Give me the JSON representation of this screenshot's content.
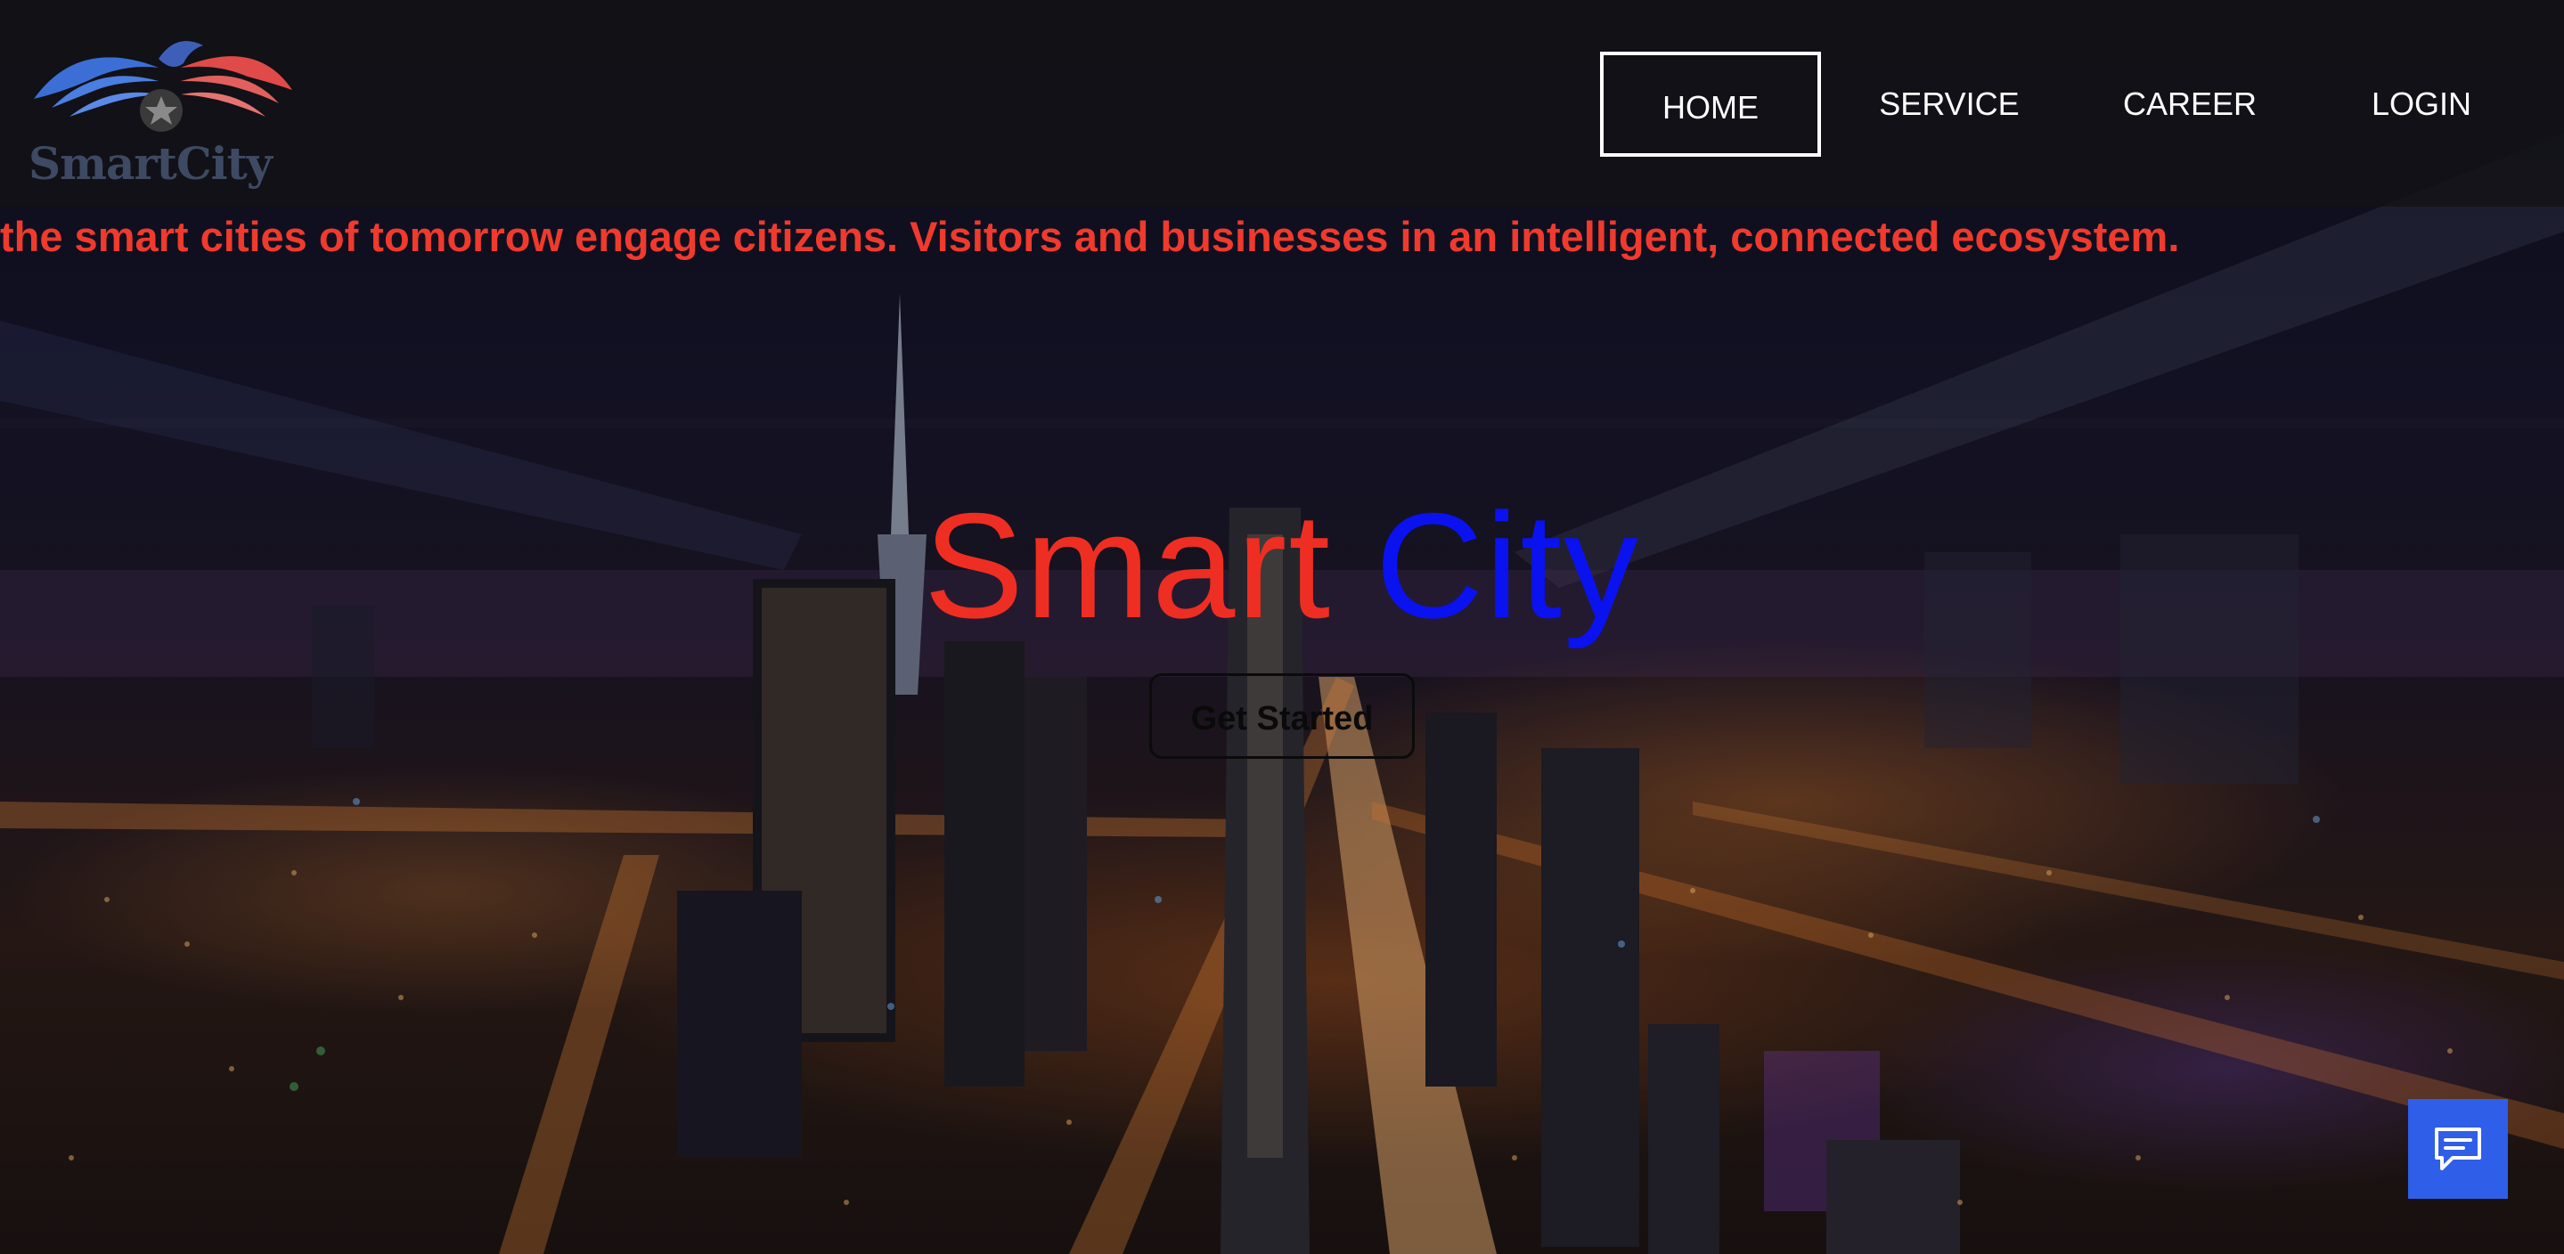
{
  "brand": {
    "logo_text": "SmartCity"
  },
  "nav": {
    "items": [
      {
        "label": "HOME",
        "active": true
      },
      {
        "label": "SERVICE",
        "active": false
      },
      {
        "label": "CAREER",
        "active": false
      },
      {
        "label": "LOGIN",
        "active": false
      }
    ]
  },
  "marquee": {
    "text": "the smart cities of tomorrow engage citizens. Visitors and businesses in an intelligent, connected ecosystem."
  },
  "hero": {
    "title_part1": "Smart",
    "title_part2": "City",
    "cta_label": "Get Started"
  },
  "chat": {
    "icon": "chat-icon"
  },
  "colors": {
    "accent_red": "#ee2e22",
    "accent_blue": "#0a12f0",
    "chat_button": "#2f5ee8"
  }
}
